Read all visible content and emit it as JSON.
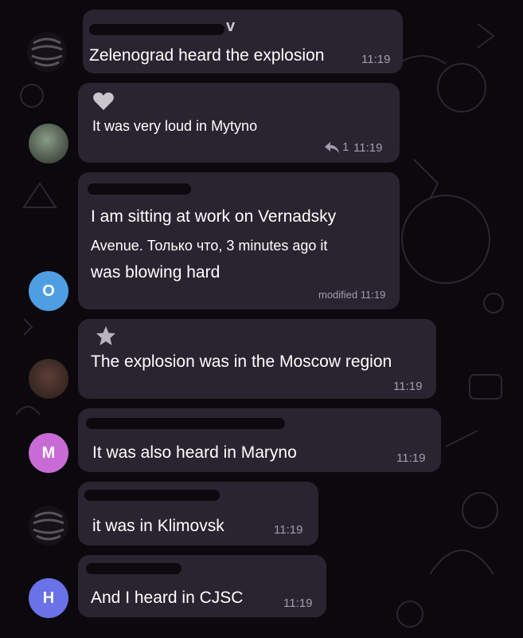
{
  "messages": [
    {
      "text": "Zelenograd heard the explosion",
      "time": "11:19",
      "sender_tail": "v"
    },
    {
      "text": "It was very loud in Mytyno",
      "time": "11:19",
      "reply_count": "1",
      "reaction_icon": "heart-icon"
    },
    {
      "text_line1": "I am sitting at work on Vernadsky",
      "text_line2": "Avenue. Только что, 3 minutes ago it",
      "text_line3": "was blowing hard",
      "time": "modified 11:19"
    },
    {
      "text": "The explosion was in the Moscow region",
      "time": "11:19",
      "reaction_icon": "star-icon"
    },
    {
      "text": "It was also heard in Maryno",
      "time": "11:19"
    },
    {
      "text": "it was in Klimovsk",
      "time": "11:19"
    },
    {
      "text": "And I heard in CJSC",
      "time": "11:19"
    }
  ],
  "avatars": {
    "o": {
      "letter": "O",
      "color": "#4f9ee3"
    },
    "m": {
      "letter": "M",
      "color": "#c86bd6"
    },
    "h": {
      "letter": "H",
      "color": "#6a72e8"
    }
  }
}
